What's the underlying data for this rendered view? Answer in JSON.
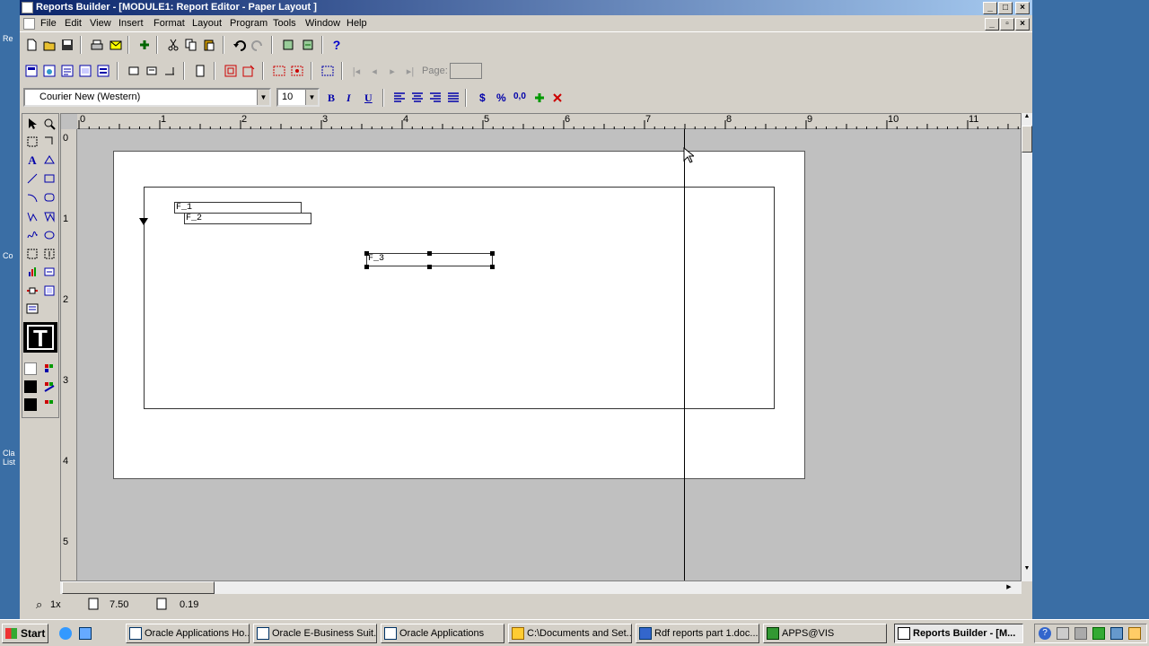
{
  "window": {
    "title": "Reports Builder - [MODULE1: Report Editor - Paper Layout ]"
  },
  "menu": [
    "File",
    "Edit",
    "View",
    "Insert",
    "Format",
    "Layout",
    "Program",
    "Tools",
    "Window",
    "Help"
  ],
  "toolbar2": {
    "page_label": "Page:",
    "page_value": ""
  },
  "font": {
    "name": "Courier New (Western)",
    "size": "10"
  },
  "format_buttons": {
    "bold": "B",
    "italic": "I",
    "underline": "U",
    "currency": "$",
    "percent": "%",
    "comma": "0,0"
  },
  "ruler": {
    "h": [
      "0",
      "1",
      "2",
      "3",
      "4",
      "5",
      "6",
      "7",
      "8",
      "9",
      "10",
      "11"
    ],
    "v": [
      "0",
      "1",
      "2",
      "3",
      "4",
      "5"
    ]
  },
  "fields": {
    "f1": "F_1",
    "f2": "F_2",
    "f3": "F_3"
  },
  "status": {
    "zoom": "1x",
    "x": "7.50",
    "y": "0.19"
  },
  "taskbar": {
    "start": "Start",
    "tasks": [
      "Oracle Applications Ho...",
      "Oracle E-Business Suit...",
      "Oracle Applications",
      "C:\\Documents and Set...",
      "Rdf reports part 1.doc...",
      "APPS@VIS",
      "Reports Builder - [M..."
    ]
  },
  "desktop_labels": [
    "Re",
    "Co",
    "Cla List"
  ],
  "colors": {
    "title_start": "#0a246a",
    "title_end": "#a6caf0",
    "face": "#d4d0c8",
    "desktop": "#3a6ea5"
  }
}
